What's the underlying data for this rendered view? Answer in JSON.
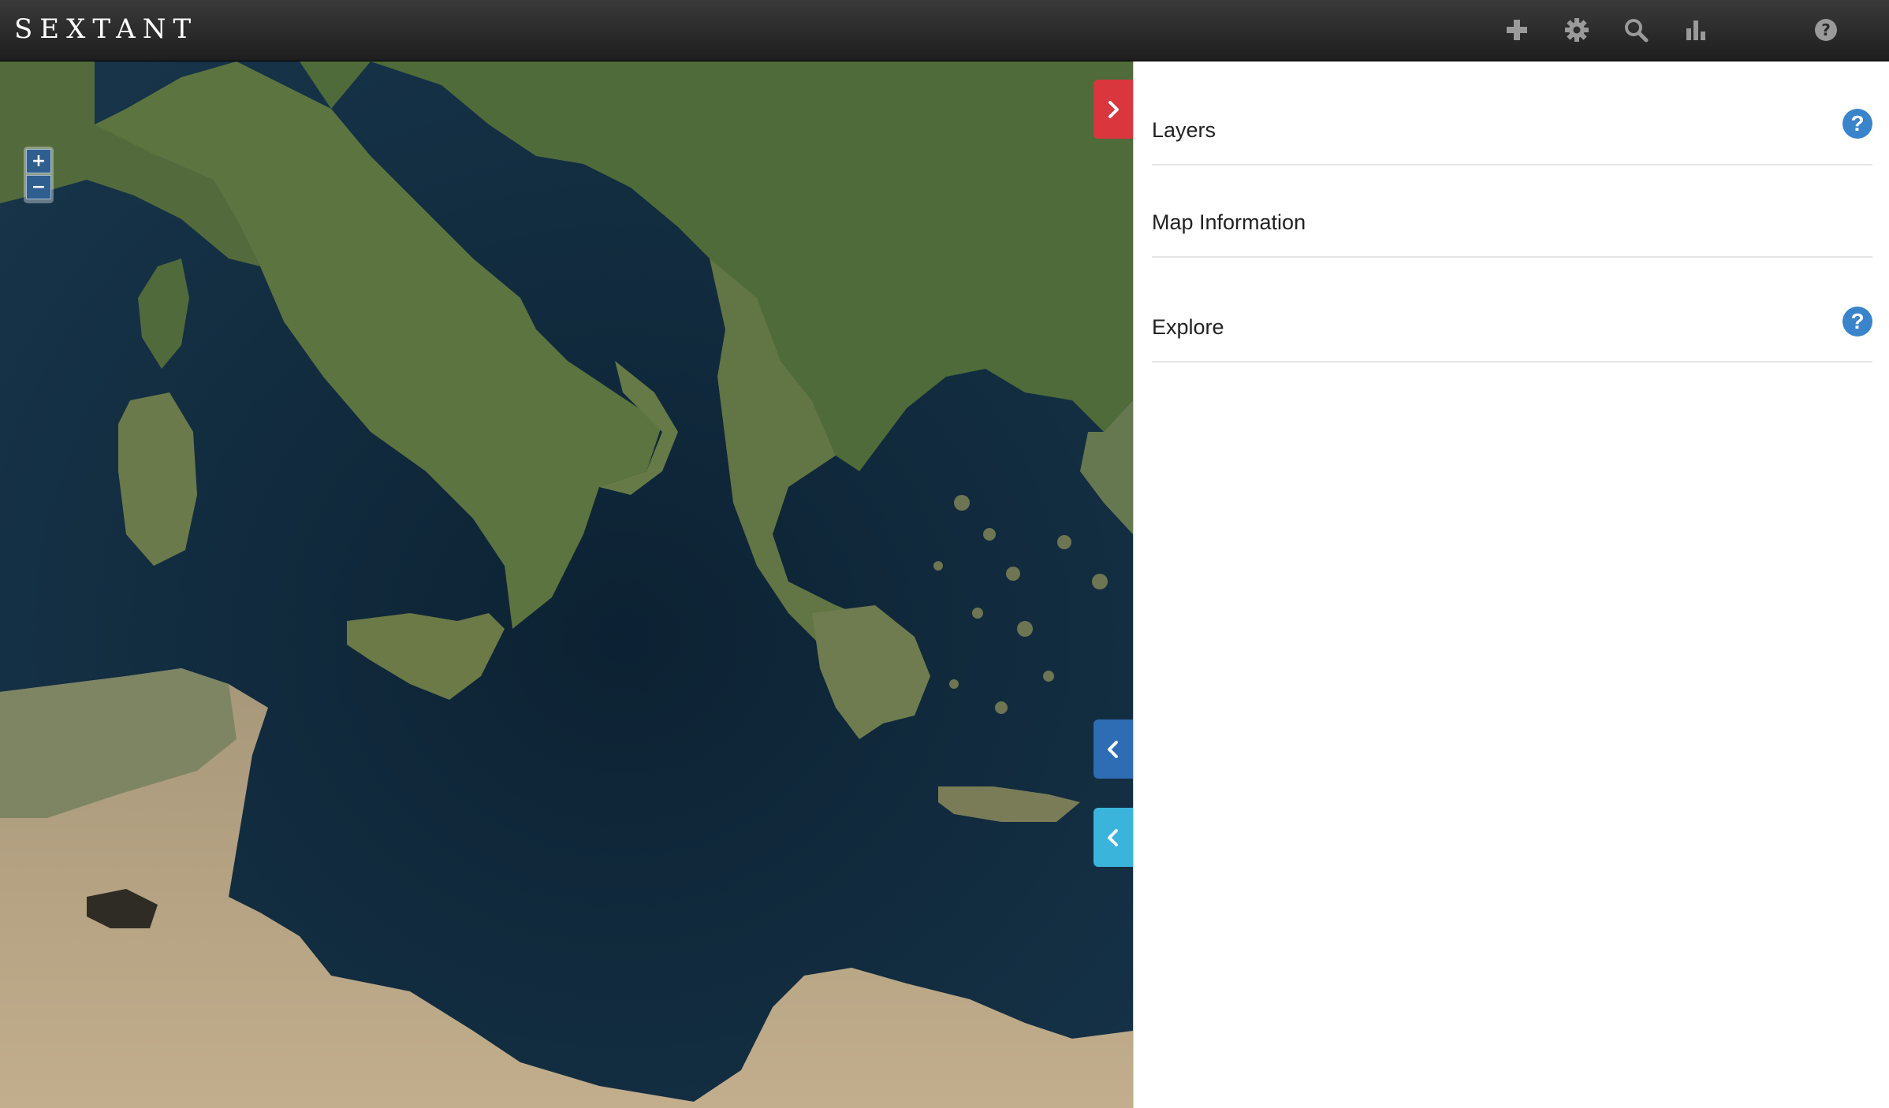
{
  "app": {
    "title": "SEXTANT"
  },
  "toolbar": {
    "icons": [
      "add-icon",
      "gear-icon",
      "search-icon",
      "bar-chart-icon",
      "help-icon"
    ]
  },
  "map": {
    "zoom_in_label": "+",
    "zoom_out_label": "−",
    "tabs": [
      {
        "icon": "chevron-right-icon",
        "color": "#d9363e"
      },
      {
        "icon": "chevron-left-icon",
        "color": "#2e6db4"
      },
      {
        "icon": "chevron-left-icon",
        "color": "#3bb4dc"
      }
    ]
  },
  "panel": {
    "sections": [
      {
        "title": "Layers",
        "has_help": true
      },
      {
        "title": "Map Information",
        "has_help": false
      },
      {
        "title": "Explore",
        "has_help": true
      }
    ],
    "help_glyph": "?"
  }
}
